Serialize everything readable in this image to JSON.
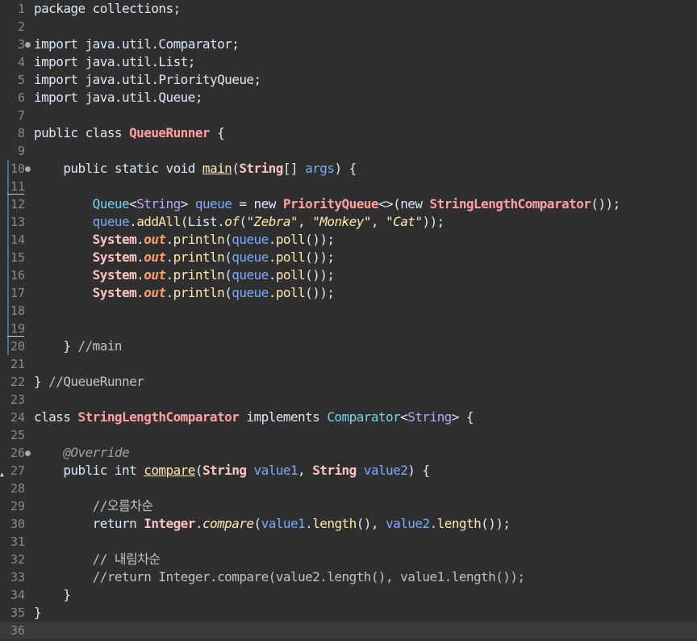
{
  "editor": {
    "lines": [
      {
        "n": "1",
        "tokens": [
          [
            "package collections;",
            "plain"
          ]
        ]
      },
      {
        "n": "2",
        "tokens": []
      },
      {
        "n": "3",
        "fold": true,
        "tokens": [
          [
            "import java.util.Comparator;",
            "plain"
          ]
        ]
      },
      {
        "n": "4",
        "tokens": [
          [
            "import java.util.List;",
            "plain"
          ]
        ]
      },
      {
        "n": "5",
        "tokens": [
          [
            "import java.util.PriorityQueue;",
            "plain"
          ]
        ]
      },
      {
        "n": "6",
        "tokens": [
          [
            "import java.util.Queue;",
            "plain"
          ]
        ]
      },
      {
        "n": "7",
        "tokens": []
      },
      {
        "n": "8",
        "tokens": [
          [
            "public class ",
            "kw"
          ],
          [
            "QueueRunner",
            "cls"
          ],
          [
            " {",
            "plain"
          ]
        ]
      },
      {
        "n": "9",
        "tokens": []
      },
      {
        "n": "10",
        "fold": true,
        "bar": true,
        "tokens": [
          [
            "    public static void ",
            "kw"
          ],
          [
            "main",
            "mdecl"
          ],
          [
            "(",
            "plain"
          ],
          [
            "String",
            "type"
          ],
          [
            "[] ",
            "plain"
          ],
          [
            "args",
            "var"
          ],
          [
            ") {",
            "plain"
          ]
        ]
      },
      {
        "n": "11",
        "bar": true,
        "underline": true,
        "tokens": []
      },
      {
        "n": "12",
        "bar": true,
        "tokens": [
          [
            "        ",
            "plain"
          ],
          [
            "Queue",
            "iface"
          ],
          [
            "<",
            "plain"
          ],
          [
            "String",
            "generic"
          ],
          [
            "> ",
            "plain"
          ],
          [
            "queue",
            "var"
          ],
          [
            " = new ",
            "plain"
          ],
          [
            "PriorityQueue",
            "cls"
          ],
          [
            "<>(new ",
            "plain"
          ],
          [
            "StringLengthComparator",
            "cls"
          ],
          [
            "());",
            "plain"
          ]
        ]
      },
      {
        "n": "13",
        "bar": true,
        "tokens": [
          [
            "        ",
            "plain"
          ],
          [
            "queue",
            "var"
          ],
          [
            ".",
            "plain"
          ],
          [
            "addAll",
            "method"
          ],
          [
            "(List.",
            "plain"
          ],
          [
            "of",
            "static-m"
          ],
          [
            "(",
            "plain"
          ],
          [
            "\"Zebra\"",
            "str"
          ],
          [
            ", ",
            "plain"
          ],
          [
            "\"Monkey\"",
            "str"
          ],
          [
            ", ",
            "plain"
          ],
          [
            "\"Cat\"",
            "str"
          ],
          [
            "));",
            "plain"
          ]
        ]
      },
      {
        "n": "14",
        "bar": true,
        "tokens": [
          [
            "        ",
            "plain"
          ],
          [
            "System",
            "sys"
          ],
          [
            ".",
            "plain"
          ],
          [
            "out",
            "field"
          ],
          [
            ".",
            "plain"
          ],
          [
            "println",
            "method"
          ],
          [
            "(",
            "plain"
          ],
          [
            "queue",
            "var"
          ],
          [
            ".",
            "plain"
          ],
          [
            "poll",
            "method"
          ],
          [
            "());",
            "plain"
          ]
        ]
      },
      {
        "n": "15",
        "bar": true,
        "tokens": [
          [
            "        ",
            "plain"
          ],
          [
            "System",
            "sys"
          ],
          [
            ".",
            "plain"
          ],
          [
            "out",
            "field"
          ],
          [
            ".",
            "plain"
          ],
          [
            "println",
            "method"
          ],
          [
            "(",
            "plain"
          ],
          [
            "queue",
            "var"
          ],
          [
            ".",
            "plain"
          ],
          [
            "poll",
            "method"
          ],
          [
            "());",
            "plain"
          ]
        ]
      },
      {
        "n": "16",
        "bar": true,
        "tokens": [
          [
            "        ",
            "plain"
          ],
          [
            "System",
            "sys"
          ],
          [
            ".",
            "plain"
          ],
          [
            "out",
            "field"
          ],
          [
            ".",
            "plain"
          ],
          [
            "println",
            "method"
          ],
          [
            "(",
            "plain"
          ],
          [
            "queue",
            "var"
          ],
          [
            ".",
            "plain"
          ],
          [
            "poll",
            "method"
          ],
          [
            "());",
            "plain"
          ]
        ]
      },
      {
        "n": "17",
        "bar": true,
        "tokens": [
          [
            "        ",
            "plain"
          ],
          [
            "System",
            "sys"
          ],
          [
            ".",
            "plain"
          ],
          [
            "out",
            "field"
          ],
          [
            ".",
            "plain"
          ],
          [
            "println",
            "method"
          ],
          [
            "(",
            "plain"
          ],
          [
            "queue",
            "var"
          ],
          [
            ".",
            "plain"
          ],
          [
            "poll",
            "method"
          ],
          [
            "());",
            "plain"
          ]
        ]
      },
      {
        "n": "18",
        "bar": true,
        "tokens": []
      },
      {
        "n": "19",
        "bar": true,
        "underline": true,
        "tokens": []
      },
      {
        "n": "20",
        "bar": true,
        "tokens": [
          [
            "    } ",
            "plain"
          ],
          [
            "//main",
            "cmt"
          ]
        ]
      },
      {
        "n": "21",
        "tokens": []
      },
      {
        "n": "22",
        "tokens": [
          [
            "} ",
            "plain"
          ],
          [
            "//QueueRunner",
            "cmt"
          ]
        ]
      },
      {
        "n": "23",
        "tokens": []
      },
      {
        "n": "24",
        "tokens": [
          [
            "class ",
            "kw"
          ],
          [
            "StringLengthComparator",
            "cls"
          ],
          [
            " implements ",
            "kw"
          ],
          [
            "Comparator",
            "iface"
          ],
          [
            "<",
            "plain"
          ],
          [
            "String",
            "generic"
          ],
          [
            "> {",
            "plain"
          ]
        ]
      },
      {
        "n": "25",
        "tokens": []
      },
      {
        "n": "26",
        "fold": true,
        "tokens": [
          [
            "    ",
            "plain"
          ],
          [
            "@Override",
            "anno"
          ]
        ]
      },
      {
        "n": "27",
        "override": true,
        "tokens": [
          [
            "    public int ",
            "kw"
          ],
          [
            "compare",
            "mdecl"
          ],
          [
            "(",
            "plain"
          ],
          [
            "String",
            "type"
          ],
          [
            " ",
            "plain"
          ],
          [
            "value1",
            "var"
          ],
          [
            ", ",
            "plain"
          ],
          [
            "String",
            "type"
          ],
          [
            " ",
            "plain"
          ],
          [
            "value2",
            "var"
          ],
          [
            ") {",
            "plain"
          ]
        ]
      },
      {
        "n": "28",
        "tokens": []
      },
      {
        "n": "29",
        "tokens": [
          [
            "        ",
            "plain"
          ],
          [
            "//오름차순",
            "cmt"
          ]
        ]
      },
      {
        "n": "30",
        "tokens": [
          [
            "        return ",
            "kw"
          ],
          [
            "Integer",
            "type"
          ],
          [
            ".",
            "plain"
          ],
          [
            "compare",
            "static-m"
          ],
          [
            "(",
            "plain"
          ],
          [
            "value1",
            "var"
          ],
          [
            ".",
            "plain"
          ],
          [
            "length",
            "method"
          ],
          [
            "(), ",
            "plain"
          ],
          [
            "value2",
            "var"
          ],
          [
            ".",
            "plain"
          ],
          [
            "length",
            "method"
          ],
          [
            "());",
            "plain"
          ]
        ]
      },
      {
        "n": "31",
        "tokens": []
      },
      {
        "n": "32",
        "tokens": [
          [
            "        ",
            "plain"
          ],
          [
            "// 내림차순",
            "cmt"
          ]
        ]
      },
      {
        "n": "33",
        "tokens": [
          [
            "        ",
            "plain"
          ],
          [
            "//return Integer.compare(value2.length(), value1.length());",
            "cmt"
          ]
        ]
      },
      {
        "n": "34",
        "tokens": [
          [
            "    }",
            "plain"
          ]
        ]
      },
      {
        "n": "35",
        "tokens": [
          [
            "}",
            "plain"
          ]
        ]
      },
      {
        "n": "36",
        "current": true,
        "tokens": []
      }
    ]
  },
  "colors": {
    "background": "#2f2f2f",
    "current_line": "#3a3a3a",
    "line_numbers": "#8a8a8a"
  }
}
